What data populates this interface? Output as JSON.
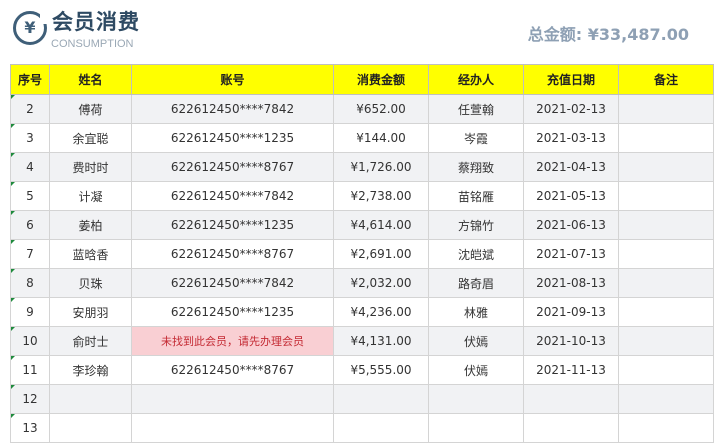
{
  "header": {
    "logo_glyph": "¥",
    "title": "会员消费",
    "subtitle": "CONSUMPTION",
    "total": "总金额: ¥33,487.00"
  },
  "table": {
    "columns": [
      "序号",
      "姓名",
      "账号",
      "消费金额",
      "经办人",
      "充值日期",
      "备注"
    ],
    "rows": [
      {
        "no": "2",
        "name": "傅荷",
        "account": "622612450****7842",
        "amount": "¥652.00",
        "handler": "任萱翰",
        "date": "2021-02-13",
        "note": ""
      },
      {
        "no": "3",
        "name": "余宜聪",
        "account": "622612450****1235",
        "amount": "¥144.00",
        "handler": "岑霞",
        "date": "2021-03-13",
        "note": ""
      },
      {
        "no": "4",
        "name": "费时时",
        "account": "622612450****8767",
        "amount": "¥1,726.00",
        "handler": "蔡翔致",
        "date": "2021-04-13",
        "note": ""
      },
      {
        "no": "5",
        "name": "计凝",
        "account": "622612450****7842",
        "amount": "¥2,738.00",
        "handler": "苗铭雁",
        "date": "2021-05-13",
        "note": ""
      },
      {
        "no": "6",
        "name": "姜柏",
        "account": "622612450****1235",
        "amount": "¥4,614.00",
        "handler": "方锦竹",
        "date": "2021-06-13",
        "note": ""
      },
      {
        "no": "7",
        "name": "蓝晗香",
        "account": "622612450****8767",
        "amount": "¥2,691.00",
        "handler": "沈皑斌",
        "date": "2021-07-13",
        "note": ""
      },
      {
        "no": "8",
        "name": "贝珠",
        "account": "622612450****7842",
        "amount": "¥2,032.00",
        "handler": "路奇眉",
        "date": "2021-08-13",
        "note": ""
      },
      {
        "no": "9",
        "name": "安朋羽",
        "account": "622612450****1235",
        "amount": "¥4,236.00",
        "handler": "林雅",
        "date": "2021-09-13",
        "note": ""
      },
      {
        "no": "10",
        "name": "俞时士",
        "account": "未找到此会员，请先办理会员",
        "amount": "¥4,131.00",
        "handler": "伏嫣",
        "date": "2021-10-13",
        "note": ""
      },
      {
        "no": "11",
        "name": "李珍翰",
        "account": "622612450****8767",
        "amount": "¥5,555.00",
        "handler": "伏嫣",
        "date": "2021-11-13",
        "note": ""
      },
      {
        "no": "12",
        "name": "",
        "account": "",
        "amount": "",
        "handler": "",
        "date": "",
        "note": ""
      },
      {
        "no": "13",
        "name": "",
        "account": "",
        "amount": "",
        "handler": "",
        "date": "",
        "note": ""
      }
    ]
  },
  "colors": {
    "header_bg": "#ffff00",
    "error_bg": "#f9cfd3",
    "error_text": "#c42a33",
    "title": "#2e4a63",
    "total": "#8ea0b4"
  }
}
